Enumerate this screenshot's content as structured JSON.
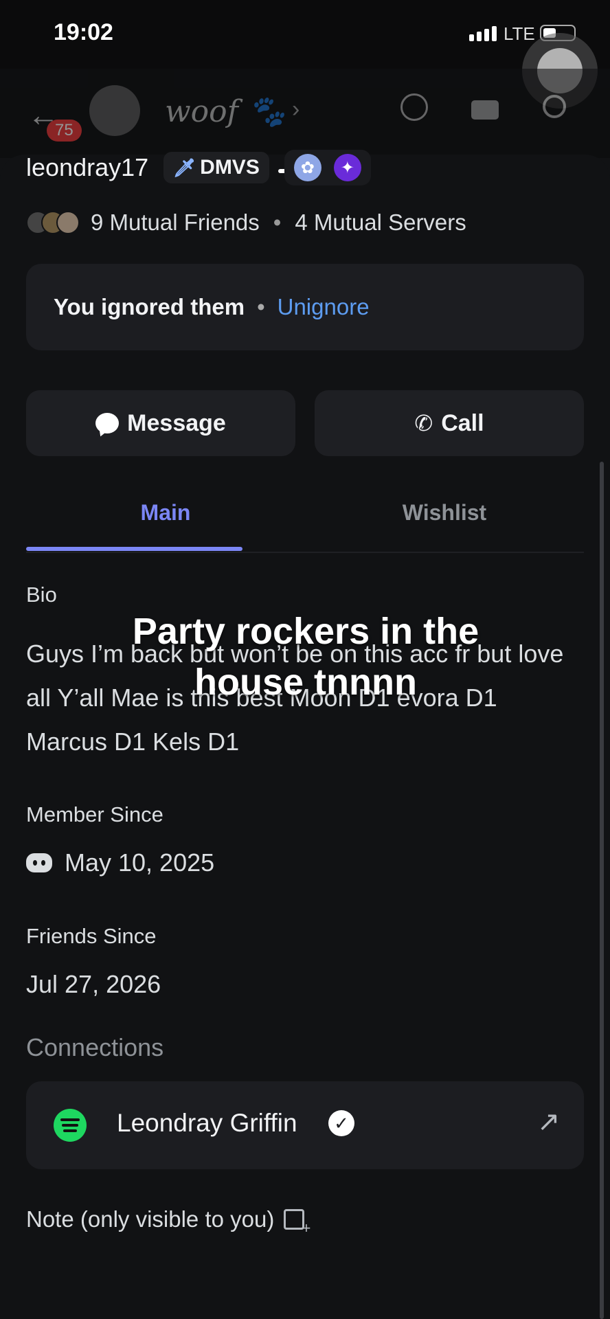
{
  "status_bar": {
    "time": "19:02",
    "network": "LTE"
  },
  "app_header": {
    "unread_badge": "75",
    "channel_name": "woof 🐾"
  },
  "profile": {
    "username": "leondray17",
    "guild_tag": "DMVS",
    "mutual_friends": "9 Mutual Friends",
    "mutual_servers": "4 Mutual Servers"
  },
  "ignored": {
    "text": "You ignored them",
    "action": "Unignore"
  },
  "actions": {
    "message_label": "Message",
    "call_label": "Call"
  },
  "tabs": {
    "main": "Main",
    "wishlist": "Wishlist"
  },
  "bio": {
    "label": "Bio",
    "text": "Guys I’m back but won’t be on this acc fr but love all Y’all  Mae is this best Moon D1 evora D1 Marcus D1 Kels D1"
  },
  "overlay_caption": "Party rockers in the house tnnnn",
  "member_since": {
    "label": "Member Since",
    "date": "May 10, 2025"
  },
  "friends_since": {
    "label": "Friends Since",
    "date": "Jul 27, 2026"
  },
  "connections": {
    "label": "Connections",
    "items": [
      {
        "service_icon": "spotify-icon",
        "name": "Leondray Griffin",
        "verified": true
      }
    ]
  },
  "note": {
    "label": "Note (only visible to you)"
  },
  "colors": {
    "accent": "#7b86f5",
    "link": "#5d9cf0",
    "spotify": "#1ed760",
    "background": "#111214"
  }
}
